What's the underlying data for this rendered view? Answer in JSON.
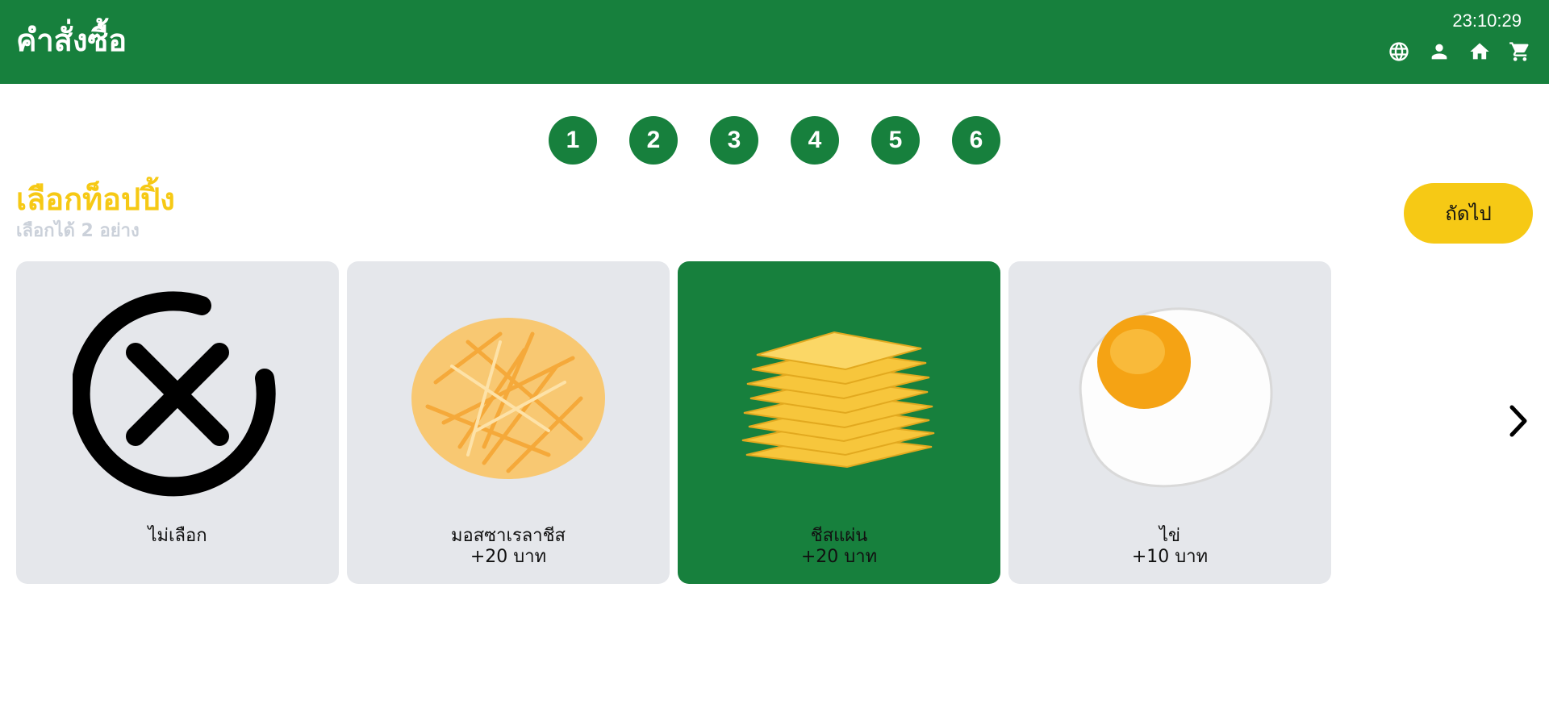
{
  "header": {
    "title": "คำสั่งซื้อ",
    "clock": "23:10:29",
    "icons": [
      "globe-icon",
      "user-icon",
      "home-icon",
      "cart-icon"
    ]
  },
  "steps": [
    "1",
    "2",
    "3",
    "4",
    "5",
    "6"
  ],
  "section": {
    "title": "เลือกท็อปปิ้ง",
    "subtitle": "เลือกได้ 2 อย่าง"
  },
  "next_button": "ถัดไป",
  "options": [
    {
      "label": "ไม่เลือก",
      "price": "",
      "selected": false,
      "image": "no-selection-icon"
    },
    {
      "label": "มอสซาเรลาชีส",
      "price": "+20 บาท",
      "selected": false,
      "image": "shredded-cheese-image"
    },
    {
      "label": "ชีสแผ่น",
      "price": "+20 บาท",
      "selected": true,
      "image": "cheese-slices-image"
    },
    {
      "label": "ไข่",
      "price": "+10 บาท",
      "selected": false,
      "image": "fried-egg-image"
    }
  ],
  "colors": {
    "primary_green": "#17803d",
    "accent_yellow": "#f6c915",
    "card_bg": "#e5e7eb",
    "subtitle_gray": "#cbd1da"
  }
}
